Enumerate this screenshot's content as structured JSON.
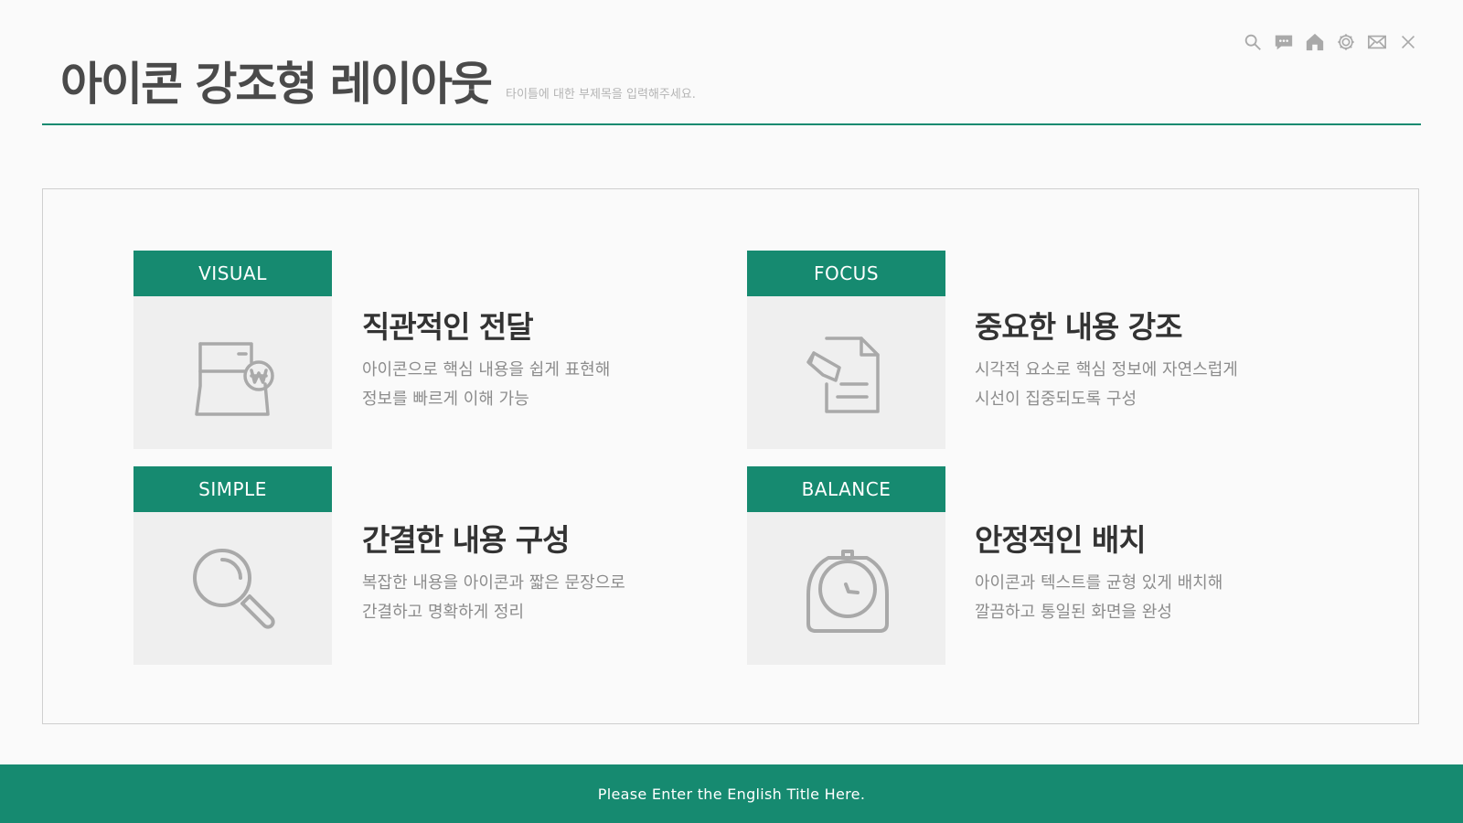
{
  "colors": {
    "accent": "#168a70",
    "icon_gray": "#a9a9a9",
    "title": "#4a4a4a"
  },
  "header": {
    "title": "아이콘 강조형 레이아웃",
    "subtitle": "타이틀에 대한 부제목을 입력해주세요."
  },
  "toolbar": {
    "icons": [
      "search-icon",
      "chat-icon",
      "home-icon",
      "settings-icon",
      "mail-icon",
      "close-icon"
    ]
  },
  "cards": [
    {
      "tag": "VISUAL",
      "icon": "wallet-won-icon",
      "heading": "직관적인 전달",
      "line1": "아이콘으로 핵심 내용을 쉽게 표현해",
      "line2": "정보를 빠르게 이해 가능"
    },
    {
      "tag": "FOCUS",
      "icon": "document-edit-icon",
      "heading": "중요한 내용 강조",
      "line1": "시각적 요소로 핵심 정보에 자연스럽게",
      "line2": "시선이 집중되도록 구성"
    },
    {
      "tag": "SIMPLE",
      "icon": "magnifier-icon",
      "heading": "간결한 내용 구성",
      "line1": "복잡한 내용을 아이콘과 짧은 문장으로",
      "line2": "간결하고 명확하게 정리"
    },
    {
      "tag": "BALANCE",
      "icon": "clock-icon",
      "heading": "안정적인 배치",
      "line1": "아이콘과 텍스트를 균형 있게 배치해",
      "line2": "깔끔하고 통일된 화면을 완성"
    }
  ],
  "footer": {
    "text": "Please Enter the English Title Here."
  }
}
